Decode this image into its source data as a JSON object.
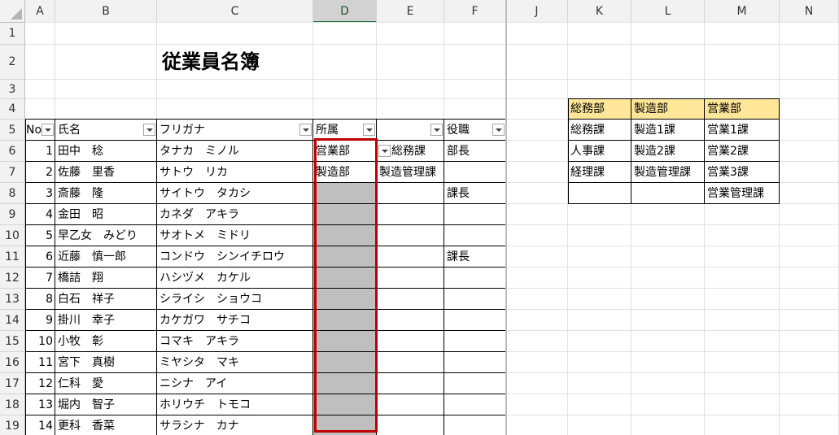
{
  "columns": [
    "A",
    "B",
    "C",
    "D",
    "E",
    "F",
    "J",
    "K",
    "L",
    "M",
    "N"
  ],
  "rows": [
    "1",
    "2",
    "3",
    "4",
    "5",
    "6",
    "7",
    "8",
    "9",
    "10",
    "11",
    "12",
    "13",
    "14",
    "15",
    "16",
    "17",
    "18",
    "19"
  ],
  "title": "従業員名簿",
  "headers": {
    "no": "No",
    "name": "氏名",
    "kana": "フリガナ",
    "dept": "所属",
    "section": "",
    "role": "役職"
  },
  "employees": [
    {
      "no": "1",
      "name": "田中　稔",
      "kana": "タナカ　ミノル",
      "dept": "営業部",
      "section": "総務課",
      "role": "部長"
    },
    {
      "no": "2",
      "name": "佐藤　里香",
      "kana": "サトウ　リカ",
      "dept": "製造部",
      "section": "製造管理課",
      "role": ""
    },
    {
      "no": "3",
      "name": "斎藤　隆",
      "kana": "サイトウ　タカシ",
      "dept": "",
      "section": "",
      "role": "課長"
    },
    {
      "no": "4",
      "name": "金田　昭",
      "kana": "カネダ　アキラ",
      "dept": "",
      "section": "",
      "role": ""
    },
    {
      "no": "5",
      "name": "早乙女　みどり",
      "kana": "サオトメ　ミドリ",
      "dept": "",
      "section": "",
      "role": ""
    },
    {
      "no": "6",
      "name": "近藤　慎一郎",
      "kana": "コンドウ　シンイチロウ",
      "dept": "",
      "section": "",
      "role": "課長"
    },
    {
      "no": "7",
      "name": "橋詰　翔",
      "kana": "ハシヅメ　カケル",
      "dept": "",
      "section": "",
      "role": ""
    },
    {
      "no": "8",
      "name": "白石　祥子",
      "kana": "シライシ　ショウコ",
      "dept": "",
      "section": "",
      "role": ""
    },
    {
      "no": "9",
      "name": "掛川　幸子",
      "kana": "カケガワ　サチコ",
      "dept": "",
      "section": "",
      "role": ""
    },
    {
      "no": "10",
      "name": "小牧　彰",
      "kana": "コマキ　アキラ",
      "dept": "",
      "section": "",
      "role": ""
    },
    {
      "no": "11",
      "name": "宮下　真樹",
      "kana": "ミヤシタ　マキ",
      "dept": "",
      "section": "",
      "role": ""
    },
    {
      "no": "12",
      "name": "仁科　愛",
      "kana": "ニシナ　アイ",
      "dept": "",
      "section": "",
      "role": ""
    },
    {
      "no": "13",
      "name": "堀内　智子",
      "kana": "ホリウチ　トモコ",
      "dept": "",
      "section": "",
      "role": ""
    },
    {
      "no": "14",
      "name": "更科　香菜",
      "kana": "サラシナ　カナ",
      "dept": "",
      "section": "",
      "role": ""
    }
  ],
  "lookup": {
    "headers": [
      "総務部",
      "製造部",
      "営業部"
    ],
    "rows": [
      [
        "総務課",
        "製造1課",
        "営業1課"
      ],
      [
        "人事課",
        "製造2課",
        "営業2課"
      ],
      [
        "経理課",
        "製造管理課",
        "営業3課"
      ],
      [
        "",
        "",
        "営業管理課"
      ]
    ]
  },
  "colors": {
    "lookup_header": "#ffe699",
    "selection_border": "#c00000",
    "selected_fill": "#bfbfbf"
  }
}
